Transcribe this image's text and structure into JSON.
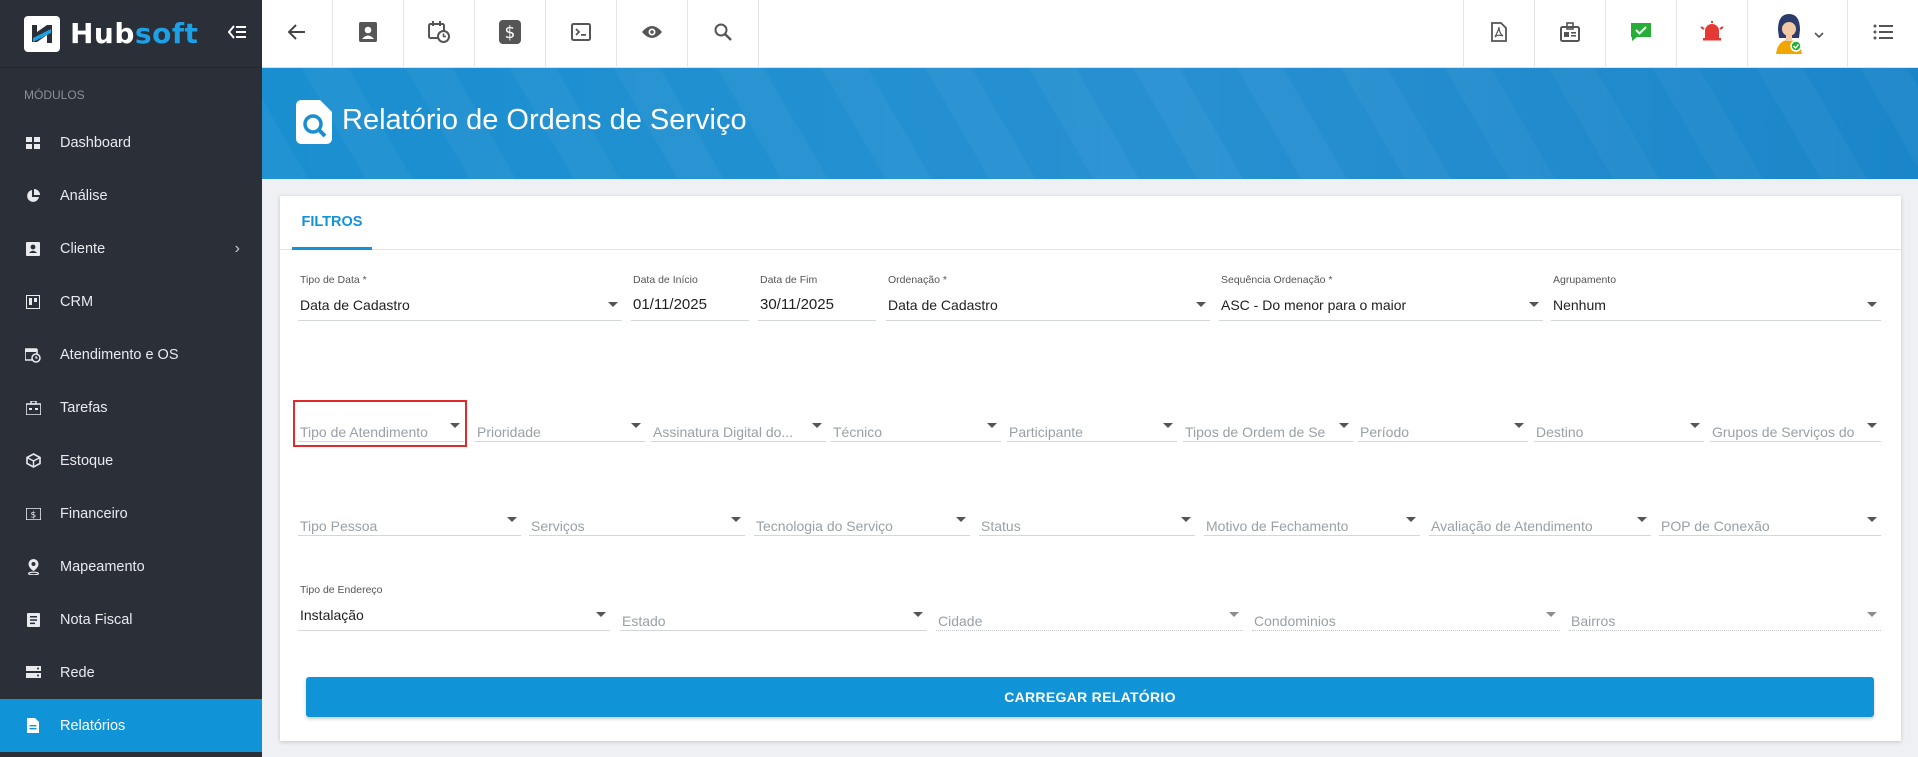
{
  "app": {
    "logo_main": "Hub",
    "logo_accent": "soft"
  },
  "sidebar": {
    "section_label": "MÓDULOS",
    "items": [
      {
        "label": "Dashboard",
        "icon": "grid-icon"
      },
      {
        "label": "Análise",
        "icon": "pie-chart-icon"
      },
      {
        "label": "Cliente",
        "icon": "contact-card-icon",
        "has_submenu": true
      },
      {
        "label": "CRM",
        "icon": "kanban-icon"
      },
      {
        "label": "Atendimento e OS",
        "icon": "calendar-clock-icon"
      },
      {
        "label": "Tarefas",
        "icon": "briefcase-icon"
      },
      {
        "label": "Estoque",
        "icon": "box-icon"
      },
      {
        "label": "Financeiro",
        "icon": "money-icon"
      },
      {
        "label": "Mapeamento",
        "icon": "map-pin-icon"
      },
      {
        "label": "Nota Fiscal",
        "icon": "document-list-icon"
      },
      {
        "label": "Rede",
        "icon": "server-icon"
      },
      {
        "label": "Relatórios",
        "icon": "report-icon",
        "active": true
      }
    ]
  },
  "page": {
    "title": "Relatório de Ordens de Serviço"
  },
  "tabs": [
    {
      "label": "FILTROS",
      "active": true
    }
  ],
  "filters": {
    "row1": {
      "tipo_data": {
        "label": "Tipo de Data *",
        "value": "Data de Cadastro"
      },
      "data_inicio": {
        "label": "Data de Início",
        "value": "01/11/2025"
      },
      "data_fim": {
        "label": "Data de Fim",
        "value": "30/11/2025"
      },
      "ordenacao": {
        "label": "Ordenação *",
        "value": "Data de Cadastro"
      },
      "sequencia": {
        "label": "Sequência Ordenação *",
        "value": "ASC - Do menor para o maior"
      },
      "agrupamento": {
        "label": "Agrupamento",
        "value": "Nenhum"
      }
    },
    "row2": [
      "Tipo de Atendimento",
      "Prioridade",
      "Assinatura Digital do...",
      "Técnico",
      "Participante",
      "Tipos de Ordem de Se",
      "Período",
      "Destino",
      "Grupos de Serviços do"
    ],
    "row3": [
      "Tipo Pessoa",
      "Serviços",
      "Tecnologia do Serviço",
      "Status",
      "Motivo de Fechamento",
      "Avaliação de Atendimento",
      "POP de Conexão"
    ],
    "row4": {
      "tipo_endereco": {
        "label": "Tipo de Endereço",
        "value": "Instalação"
      },
      "placeholders": [
        "Estado",
        "Cidade",
        "Condominios",
        "Bairros"
      ]
    }
  },
  "actions": {
    "load_report": "CARREGAR RELATÓRIO"
  },
  "colors": {
    "accent": "#1193d8",
    "sidebar_bg": "#2b2f38",
    "highlight": "#e12b2b"
  }
}
